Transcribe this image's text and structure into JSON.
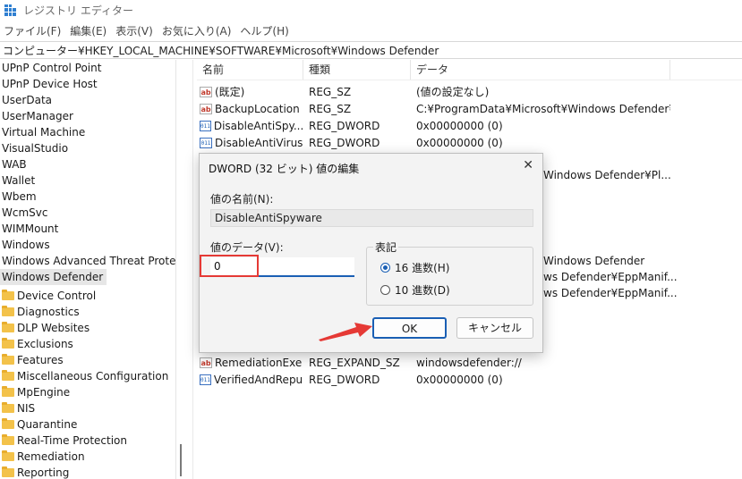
{
  "window": {
    "title": "レジストリ エディター"
  },
  "menu": [
    "ファイル(F)",
    "編集(E)",
    "表示(V)",
    "お気に入り(A)",
    "ヘルプ(H)"
  ],
  "address": "コンピューター¥HKEY_LOCAL_MACHINE¥SOFTWARE¥Microsoft¥Windows Defender",
  "tree": {
    "items": [
      "UPnP Control Point",
      "UPnP Device Host",
      "UserData",
      "UserManager",
      "Virtual Machine",
      "VisualStudio",
      "WAB",
      "Wallet",
      "Wbem",
      "WcmSvc",
      "WIMMount",
      "Windows",
      "Windows Advanced Threat Protectio"
    ],
    "selected": "Windows Defender",
    "children": [
      "Device Control",
      "Diagnostics",
      "DLP Websites",
      "Exclusions",
      "Features",
      "Miscellaneous Configuration",
      "MpEngine",
      "NIS",
      "Quarantine",
      "Real-Time Protection",
      "Remediation",
      "Reporting"
    ]
  },
  "list": {
    "headers": {
      "name": "名前",
      "type": "種類",
      "data": "データ"
    },
    "rows": [
      {
        "icon": "ab",
        "name": "(既定)",
        "type": "REG_SZ",
        "data": "(値の設定なし)"
      },
      {
        "icon": "ab",
        "name": "BackupLocation",
        "type": "REG_SZ",
        "data": "C:¥ProgramData¥Microsoft¥Windows Defender¥Pl..."
      },
      {
        "icon": "dw",
        "name": "DisableAntiSpy...",
        "type": "REG_DWORD",
        "data": "0x00000000 (0)"
      },
      {
        "icon": "dw",
        "name": "DisableAntiVirus",
        "type": "REG_DWORD",
        "data": "0x00000000 (0)"
      }
    ],
    "hidden_partial": [
      "Windows Defender¥Pl...",
      "Windows Defender",
      "ws Defender¥EppManif...",
      "ws Defender¥EppManif..."
    ],
    "bottom_rows": [
      {
        "icon": "ab",
        "name": "RemediationExe",
        "type": "REG_EXPAND_SZ",
        "data": "windowsdefender://"
      },
      {
        "icon": "dw",
        "name": "VerifiedAndRepu...",
        "type": "REG_DWORD",
        "data": "0x00000000 (0)"
      }
    ]
  },
  "dialog": {
    "title": "DWORD (32 ビット) 値の編集",
    "close_icon": "close-icon",
    "name_label": "値の名前(N):",
    "name_value": "DisableAntiSpyware",
    "value_label": "値のデータ(V):",
    "value": "0",
    "base_label": "表記",
    "radio_hex": "16 進数(H)",
    "radio_dec": "10 進数(D)",
    "selected_base": "hex",
    "ok_label": "OK",
    "cancel_label": "キャンセル"
  },
  "colors": {
    "accent": "#1a5fb4",
    "annotation": "#e53935",
    "folder": "#f3c24a"
  }
}
